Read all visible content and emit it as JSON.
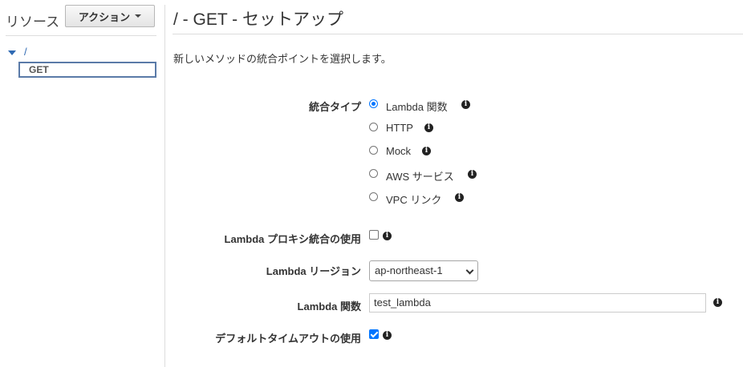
{
  "sidebar": {
    "title": "リソース",
    "action_button": "アクション",
    "tree": {
      "root": "/",
      "method": "GET"
    }
  },
  "main": {
    "title": "/ - GET - セットアップ",
    "description": "新しいメソッドの統合ポイントを選択します。",
    "integration_type": {
      "label": "統合タイプ",
      "options": [
        {
          "label": "Lambda 関数",
          "selected": true
        },
        {
          "label": "HTTP",
          "selected": false
        },
        {
          "label": "Mock",
          "selected": false
        },
        {
          "label": "AWS サービス",
          "selected": false
        },
        {
          "label": "VPC リンク",
          "selected": false
        }
      ]
    },
    "lambda_proxy": {
      "label": "Lambda プロキシ統合の使用",
      "checked": false
    },
    "lambda_region": {
      "label": "Lambda リージョン",
      "value": "ap-northeast-1"
    },
    "lambda_function": {
      "label": "Lambda 関数",
      "value": "test_lambda"
    },
    "default_timeout": {
      "label": "デフォルトタイムアウトの使用",
      "checked": true
    }
  },
  "colors": {
    "link": "#2f6ab3",
    "accent": "#0075ff",
    "divider": "#dddddd"
  },
  "icons": {
    "info": "info-icon",
    "caret": "caret-down-icon"
  }
}
